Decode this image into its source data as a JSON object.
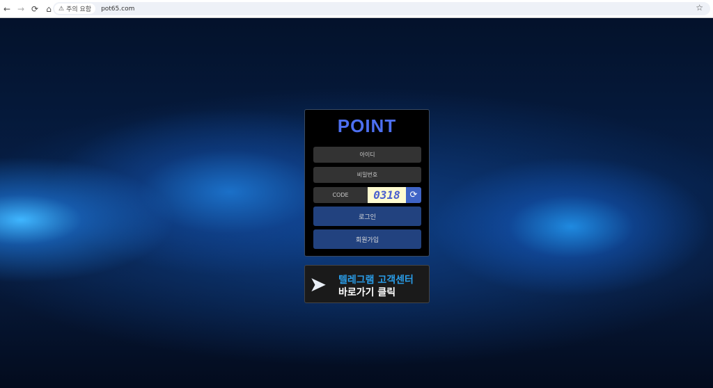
{
  "browser": {
    "back": "←",
    "forward": "→",
    "reload": "⟳",
    "home": "⌂",
    "warning_label": "주의 요함",
    "url": "pot65.com",
    "bookmark": "☆"
  },
  "login": {
    "logo": "POINT",
    "id_placeholder": "아이디",
    "pw_placeholder": "비밀번호",
    "code_label": "CODE",
    "captcha": "0318",
    "login_label": "로그인",
    "signup_label": "회원가입"
  },
  "telegram": {
    "line1": "텔레그램 고객센터",
    "line2": "바로가기 클릭"
  },
  "colors": {
    "accent": "#22427f",
    "logo": "#4d6ff0",
    "telegram": "#2a9de8"
  }
}
